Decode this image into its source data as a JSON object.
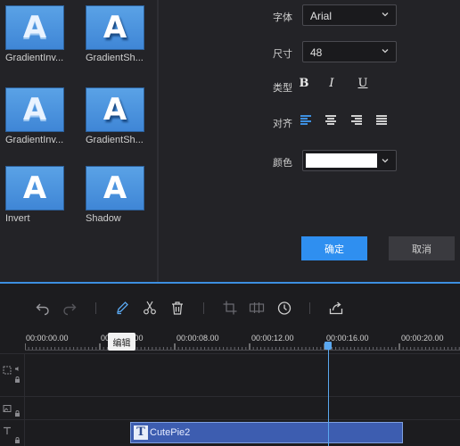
{
  "library": {
    "tiles": [
      {
        "label": "GradientInv...",
        "glyph": "A",
        "style": "gradient"
      },
      {
        "label": "GradientSh...",
        "glyph": "A",
        "style": "gradient-shadow"
      },
      {
        "label": "GradientInv...",
        "glyph": "A",
        "style": "gradient"
      },
      {
        "label": "GradientSh...",
        "glyph": "A",
        "style": "gradient-shadow"
      },
      {
        "label": "Invert",
        "glyph": "A",
        "style": "plain"
      },
      {
        "label": "Shadow",
        "glyph": "A",
        "style": "plain"
      }
    ]
  },
  "properties": {
    "font_label": "字体",
    "font_value": "Arial",
    "size_label": "尺寸",
    "size_value": "48",
    "type_label": "类型",
    "bold": "B",
    "italic": "I",
    "underline": "U",
    "align_label": "对齐",
    "align_options": [
      "left",
      "center",
      "right",
      "justify"
    ],
    "align_selected": "left",
    "color_label": "颜色",
    "color_value": "#ffffff",
    "ok_label": "确定",
    "cancel_label": "取消"
  },
  "toolbar": {
    "items": [
      "undo-icon",
      "redo-icon",
      "edit-icon",
      "cut-icon",
      "delete-icon",
      "crop-icon",
      "mosaic-icon",
      "duration-icon",
      "export-icon"
    ],
    "tooltip": "编辑"
  },
  "timeline": {
    "ticks": [
      "00:00:00.00",
      "00:00:04.00",
      "00:00:08.00",
      "00:00:12.00",
      "00:00:16.00",
      "00:00:20.00"
    ],
    "clip_label": "CutePie2",
    "clip_icon": "T",
    "playhead": "00:00:16.00"
  },
  "colors": {
    "accent": "#2f8ff0",
    "clip": "#3d5db0",
    "thumb": "#4a92de",
    "background": "#1c1c1f"
  }
}
